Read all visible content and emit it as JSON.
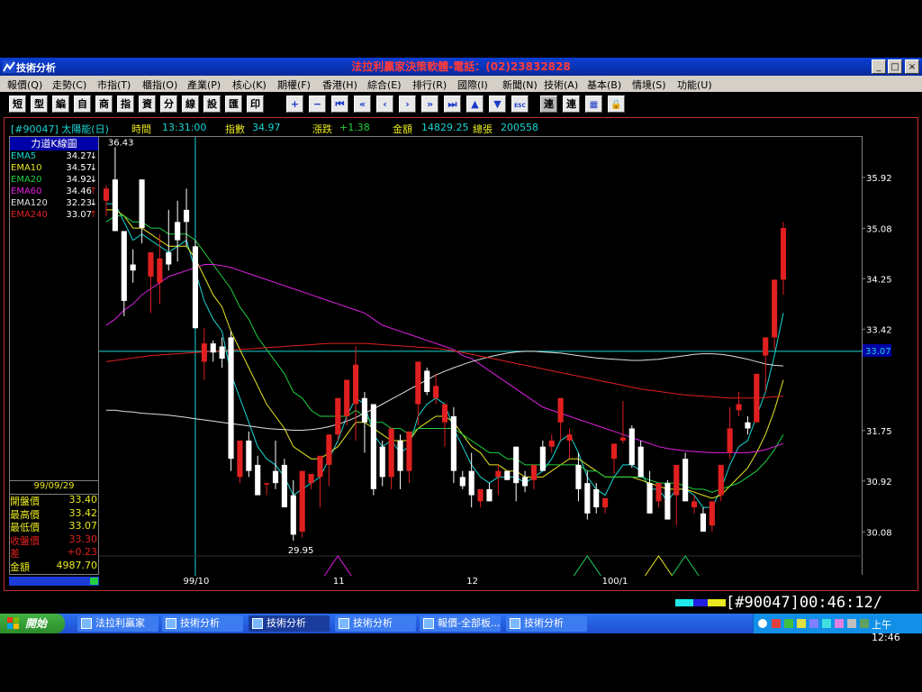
{
  "window": {
    "app_title": "技術分析",
    "center_title": "法拉利贏家決策軟體-電話：(02)23832828",
    "buttons": [
      "_",
      "□",
      "×"
    ]
  },
  "menu": [
    "報價(Q)",
    "走勢(C)",
    "市指(T)",
    "櫃指(O)",
    "產業(P)",
    "核心(K)",
    "期權(F)",
    "香港(H)",
    "綜合(E)",
    "排行(R)",
    "國際(I)",
    "新聞(N)",
    "技術(A)",
    "基本(B)",
    "情境(S)",
    "功能(U)"
  ],
  "toolbar": {
    "text_buttons": [
      "短",
      "型",
      "編",
      "自",
      "商",
      "指",
      "資",
      "分",
      "線",
      "設",
      "匯",
      "印"
    ],
    "icon_buttons": [
      "plus-icon",
      "minus-icon",
      "first-icon",
      "prev-page-icon",
      "prev-icon",
      "next-icon",
      "next-page-icon",
      "last-icon",
      "up-icon",
      "down-icon",
      "esc-icon"
    ],
    "esc_label": "ESC",
    "link_buttons": [
      "連",
      "連"
    ],
    "tail_icons": [
      "grid-icon",
      "lock-icon"
    ]
  },
  "infobar": {
    "code_name": "[#90047] 太陽能(日)",
    "time_label": "時間",
    "time_value": "13:31:00",
    "index_label": "指數",
    "index_value": "34.97",
    "change_label": "漲跌",
    "change_value": "+1.38",
    "amount_label": "金額",
    "amount_value": "14829.25",
    "total_label": "總張",
    "total_value": "200558"
  },
  "left_panel": {
    "title": "力道K線圖",
    "ema": [
      {
        "name": "EMA5",
        "value": "34.27",
        "arrow": "↓",
        "color": "#18d6d6"
      },
      {
        "name": "EMA10",
        "value": "34.57",
        "arrow": "↓",
        "color": "#e8e820"
      },
      {
        "name": "EMA20",
        "value": "34.92",
        "arrow": "↓",
        "color": "#20d040"
      },
      {
        "name": "EMA60",
        "value": "34.46",
        "arrow": "↑",
        "color": "#e020e0"
      },
      {
        "name": "EMA120",
        "value": "32.23",
        "arrow": "↓",
        "color": "#e0e0e0"
      },
      {
        "name": "EMA240",
        "value": "33.07",
        "arrow": "↑",
        "color": "#e02020"
      }
    ],
    "date": "99/09/29",
    "ohlc": [
      {
        "name": "開盤價",
        "value": "33.40",
        "color": "#e8e820"
      },
      {
        "name": "最高價",
        "value": "33.42",
        "color": "#e8e820"
      },
      {
        "name": "最低價",
        "value": "33.07",
        "color": "#e8e820"
      },
      {
        "name": "收盤價",
        "value": "33.30",
        "color": "#e02020"
      },
      {
        "name": "差",
        "value": "+0.23",
        "color": "#e02020"
      },
      {
        "name": "金額",
        "value": "4987.70",
        "color": "#e8e820"
      }
    ]
  },
  "chart_data": {
    "type": "candlestick",
    "y_range": [
      29.7,
      36.6
    ],
    "y_ticks": [
      "35.92",
      "35.08",
      "34.25",
      "33.42",
      "31.75",
      "30.92",
      "30.08"
    ],
    "current_price_label": "33.07",
    "current_price": 33.07,
    "x_labels": [
      {
        "label": "99/10",
        "index": 10
      },
      {
        "label": "11",
        "index": 26
      },
      {
        "label": "12",
        "index": 41
      },
      {
        "label": "100/1",
        "index": 57
      }
    ],
    "cursor_index": 10,
    "high_label": "36.43",
    "low_label": "29.95",
    "colors": {
      "up": "#e02020",
      "down": "#ffffff",
      "grid": "#18d6d6"
    },
    "candles": [
      [
        35.55,
        35.8,
        35.3,
        35.75
      ],
      [
        35.9,
        36.43,
        35.05,
        35.05
      ],
      [
        35.05,
        35.05,
        33.65,
        33.9
      ],
      [
        34.5,
        34.75,
        34.2,
        34.4
      ],
      [
        35.9,
        35.9,
        34.85,
        35.1
      ],
      [
        34.3,
        34.3,
        33.7,
        34.7
      ],
      [
        34.2,
        35.0,
        33.85,
        34.6
      ],
      [
        34.7,
        35.4,
        34.4,
        34.5
      ],
      [
        35.2,
        35.55,
        34.55,
        34.9
      ],
      [
        35.4,
        35.75,
        34.8,
        35.2
      ],
      [
        34.8,
        34.9,
        33.5,
        33.45
      ],
      [
        32.9,
        33.45,
        32.6,
        33.2
      ],
      [
        33.2,
        33.25,
        32.9,
        33.05
      ],
      [
        33.15,
        33.3,
        32.8,
        32.95
      ],
      [
        33.3,
        33.4,
        31.1,
        31.3
      ],
      [
        31.0,
        31.5,
        30.9,
        31.6
      ],
      [
        31.6,
        31.75,
        31.0,
        31.1
      ],
      [
        31.2,
        31.35,
        30.75,
        30.7
      ],
      [
        30.9,
        30.9,
        30.7,
        30.9
      ],
      [
        31.1,
        31.6,
        30.8,
        30.9
      ],
      [
        31.2,
        31.3,
        30.7,
        30.5
      ],
      [
        30.7,
        30.95,
        29.95,
        30.05
      ],
      [
        30.1,
        30.3,
        30.0,
        31.1
      ],
      [
        30.9,
        31.0,
        30.8,
        31.05
      ],
      [
        31.0,
        31.1,
        30.5,
        31.35
      ],
      [
        31.2,
        31.4,
        30.85,
        31.7
      ],
      [
        31.7,
        31.9,
        31.6,
        32.3
      ],
      [
        32.0,
        32.4,
        31.85,
        32.6
      ],
      [
        32.2,
        33.15,
        31.6,
        32.85
      ],
      [
        32.3,
        32.4,
        31.4,
        31.9
      ],
      [
        32.2,
        32.2,
        30.7,
        30.8
      ],
      [
        31.5,
        31.6,
        30.85,
        31.0
      ],
      [
        31.0,
        31.2,
        30.8,
        31.8
      ],
      [
        31.6,
        31.7,
        30.8,
        31.1
      ],
      [
        31.1,
        31.3,
        30.9,
        31.75
      ],
      [
        32.2,
        32.8,
        31.85,
        32.9
      ],
      [
        32.75,
        32.8,
        32.35,
        32.4
      ],
      [
        32.3,
        32.7,
        32.2,
        32.5
      ],
      [
        31.9,
        32.0,
        31.5,
        32.2
      ],
      [
        32.0,
        32.15,
        30.9,
        31.1
      ],
      [
        31.0,
        31.1,
        30.8,
        30.85
      ],
      [
        31.1,
        31.4,
        30.5,
        30.7
      ],
      [
        30.6,
        30.7,
        30.5,
        30.8
      ],
      [
        30.8,
        30.9,
        30.6,
        30.6
      ],
      [
        31.0,
        31.2,
        30.7,
        31.1
      ],
      [
        31.1,
        31.1,
        30.95,
        30.95
      ],
      [
        31.5,
        31.5,
        30.6,
        30.9
      ],
      [
        31.0,
        31.1,
        30.75,
        30.85
      ],
      [
        30.95,
        31.1,
        30.8,
        31.2
      ],
      [
        31.5,
        31.6,
        31.4,
        31.1
      ],
      [
        31.5,
        31.7,
        31.4,
        31.6
      ],
      [
        31.9,
        32.25,
        31.6,
        32.3
      ],
      [
        31.6,
        31.8,
        31.3,
        31.7
      ],
      [
        31.2,
        31.4,
        30.6,
        30.8
      ],
      [
        30.9,
        31.1,
        30.3,
        30.4
      ],
      [
        30.8,
        30.9,
        30.4,
        30.5
      ],
      [
        30.5,
        30.6,
        30.4,
        30.65
      ],
      [
        31.3,
        31.4,
        31.05,
        31.55
      ],
      [
        31.6,
        32.25,
        31.55,
        31.65
      ],
      [
        31.8,
        31.85,
        31.15,
        31.2
      ],
      [
        31.5,
        31.6,
        31.0,
        31.0
      ],
      [
        30.9,
        31.1,
        30.4,
        30.4
      ],
      [
        30.6,
        30.8,
        30.5,
        30.9
      ],
      [
        30.9,
        30.95,
        30.3,
        30.3
      ],
      [
        30.7,
        30.8,
        30.2,
        31.2
      ],
      [
        31.3,
        31.4,
        30.6,
        30.6
      ],
      [
        30.5,
        30.7,
        30.4,
        30.6
      ],
      [
        30.4,
        30.5,
        30.2,
        30.1
      ],
      [
        30.2,
        30.4,
        30.1,
        30.6
      ],
      [
        30.7,
        30.9,
        30.6,
        31.2
      ],
      [
        31.4,
        32.15,
        31.3,
        31.8
      ],
      [
        32.1,
        32.4,
        32.0,
        32.2
      ],
      [
        31.9,
        32.0,
        31.7,
        31.8
      ],
      [
        31.9,
        32.6,
        31.9,
        32.7
      ],
      [
        33.0,
        33.1,
        32.4,
        33.3
      ],
      [
        33.3,
        33.6,
        33.1,
        34.25
      ],
      [
        34.25,
        35.2,
        34.0,
        35.1
      ]
    ],
    "series": [
      {
        "name": "EMA5",
        "color": "#18d6d6",
        "values": [
          35.5,
          35.5,
          35.2,
          34.9,
          35.0,
          34.9,
          34.8,
          34.7,
          34.8,
          34.9,
          34.4,
          33.9,
          33.6,
          33.4,
          32.7,
          32.3,
          31.9,
          31.5,
          31.3,
          31.2,
          31.0,
          30.7,
          30.8,
          30.9,
          31.0,
          31.3,
          31.6,
          32.0,
          32.3,
          32.2,
          31.7,
          31.5,
          31.6,
          31.4,
          31.5,
          32.0,
          32.2,
          32.3,
          32.2,
          31.8,
          31.5,
          31.2,
          31.0,
          30.9,
          31.0,
          31.0,
          31.0,
          30.9,
          31.0,
          31.1,
          31.3,
          31.6,
          31.7,
          31.4,
          31.0,
          30.8,
          30.7,
          31.0,
          31.2,
          31.2,
          31.1,
          30.8,
          30.8,
          30.6,
          30.8,
          30.8,
          30.7,
          30.5,
          30.5,
          30.8,
          31.2,
          31.5,
          31.6,
          32.0,
          32.4,
          33.0,
          33.7
        ]
      },
      {
        "name": "EMA10",
        "color": "#e8e820",
        "values": [
          35.4,
          35.4,
          35.3,
          35.1,
          35.1,
          35.0,
          34.9,
          34.8,
          34.8,
          34.8,
          34.6,
          34.3,
          34.0,
          33.8,
          33.4,
          33.1,
          32.8,
          32.5,
          32.2,
          32.0,
          31.8,
          31.5,
          31.4,
          31.3,
          31.3,
          31.4,
          31.5,
          31.7,
          31.9,
          31.9,
          31.8,
          31.7,
          31.6,
          31.6,
          31.6,
          31.8,
          31.9,
          32.0,
          32.0,
          31.9,
          31.7,
          31.5,
          31.4,
          31.2,
          31.2,
          31.1,
          31.1,
          31.0,
          31.0,
          31.0,
          31.1,
          31.2,
          31.3,
          31.3,
          31.2,
          31.1,
          31.0,
          31.0,
          31.0,
          31.0,
          30.95,
          30.9,
          30.85,
          30.8,
          30.8,
          30.8,
          30.75,
          30.7,
          30.65,
          30.7,
          30.85,
          31.0,
          31.15,
          31.4,
          31.7,
          32.1,
          32.6
        ]
      },
      {
        "name": "EMA20",
        "color": "#20d040",
        "values": [
          35.2,
          35.3,
          35.3,
          35.2,
          35.2,
          35.1,
          35.1,
          35.0,
          35.0,
          35.0,
          34.9,
          34.7,
          34.5,
          34.3,
          34.1,
          33.8,
          33.6,
          33.3,
          33.1,
          32.9,
          32.7,
          32.4,
          32.3,
          32.1,
          32.0,
          32.0,
          32.0,
          32.0,
          32.1,
          32.0,
          31.9,
          31.9,
          31.8,
          31.8,
          31.7,
          31.8,
          31.8,
          31.8,
          31.8,
          31.8,
          31.7,
          31.6,
          31.5,
          31.4,
          31.4,
          31.3,
          31.3,
          31.2,
          31.2,
          31.2,
          31.2,
          31.2,
          31.2,
          31.2,
          31.1,
          31.1,
          31.0,
          31.0,
          31.0,
          31.0,
          31.0,
          30.95,
          30.9,
          30.9,
          30.9,
          30.85,
          30.8,
          30.8,
          30.75,
          30.8,
          30.85,
          30.9,
          31.0,
          31.1,
          31.25,
          31.45,
          31.7
        ]
      },
      {
        "name": "EMA60",
        "color": "#e020e0",
        "values": [
          33.5,
          33.6,
          33.75,
          33.85,
          34.0,
          34.1,
          34.2,
          34.3,
          34.35,
          34.4,
          34.45,
          34.5,
          34.5,
          34.48,
          34.45,
          34.4,
          34.35,
          34.3,
          34.25,
          34.2,
          34.15,
          34.1,
          34.05,
          34.0,
          33.95,
          33.9,
          33.85,
          33.8,
          33.75,
          33.7,
          33.6,
          33.5,
          33.45,
          33.4,
          33.35,
          33.3,
          33.25,
          33.2,
          33.15,
          33.1,
          33.0,
          32.95,
          32.85,
          32.75,
          32.65,
          32.55,
          32.45,
          32.35,
          32.25,
          32.15,
          32.1,
          32.05,
          32.0,
          31.95,
          31.9,
          31.85,
          31.8,
          31.75,
          31.7,
          31.65,
          31.6,
          31.55,
          31.5,
          31.47,
          31.45,
          31.43,
          31.42,
          31.41,
          31.4,
          31.4,
          31.4,
          31.4,
          31.4,
          31.42,
          31.45,
          31.5,
          31.55
        ]
      },
      {
        "name": "EMA120",
        "color": "#e0e0e0",
        "values": [
          32.1,
          32.1,
          32.08,
          32.07,
          32.05,
          32.04,
          32.03,
          32.02,
          32.0,
          31.98,
          31.96,
          31.94,
          31.92,
          31.9,
          31.88,
          31.86,
          31.84,
          31.82,
          31.8,
          31.79,
          31.78,
          31.77,
          31.77,
          31.78,
          31.8,
          31.83,
          31.87,
          31.92,
          31.98,
          32.05,
          32.12,
          32.2,
          32.28,
          32.36,
          32.44,
          32.52,
          32.6,
          32.68,
          32.74,
          32.8,
          32.85,
          32.9,
          32.94,
          32.98,
          33.01,
          33.04,
          33.06,
          33.07,
          33.07,
          33.06,
          33.05,
          33.04,
          33.02,
          33.0,
          32.98,
          32.96,
          32.95,
          32.94,
          32.93,
          32.92,
          32.92,
          32.93,
          32.94,
          32.96,
          32.98,
          33.0,
          33.02,
          33.03,
          33.03,
          33.02,
          33.0,
          32.97,
          32.94,
          32.9,
          32.86,
          32.84,
          32.83
        ]
      },
      {
        "name": "EMA240",
        "color": "#e02020",
        "values": [
          32.9,
          32.92,
          32.94,
          32.96,
          32.98,
          33.0,
          33.01,
          33.02,
          33.03,
          33.04,
          33.05,
          33.06,
          33.07,
          33.08,
          33.09,
          33.1,
          33.11,
          33.12,
          33.13,
          33.14,
          33.15,
          33.16,
          33.17,
          33.18,
          33.19,
          33.2,
          33.2,
          33.2,
          33.2,
          33.2,
          33.19,
          33.18,
          33.17,
          33.16,
          33.15,
          33.14,
          33.13,
          33.12,
          33.1,
          33.08,
          33.05,
          33.02,
          32.99,
          32.96,
          32.93,
          32.9,
          32.87,
          32.84,
          32.81,
          32.78,
          32.75,
          32.72,
          32.69,
          32.66,
          32.63,
          32.6,
          32.57,
          32.54,
          32.51,
          32.48,
          32.45,
          32.43,
          32.41,
          32.39,
          32.37,
          32.35,
          32.34,
          32.33,
          32.32,
          32.31,
          32.3,
          32.3,
          32.3,
          32.3,
          32.31,
          32.32,
          32.33
        ]
      }
    ],
    "signals": [
      26,
      54,
      62,
      65
    ]
  },
  "bottom": {
    "code": "[#90047]00:46:12/"
  },
  "taskbar": {
    "start_label": "開始",
    "tasks": [
      {
        "label": "法拉利贏家",
        "active": false
      },
      {
        "label": "技術分析",
        "active": false
      },
      {
        "label": "技術分析",
        "active": true
      },
      {
        "label": "技術分析",
        "active": false
      },
      {
        "label": "報價-全部板...",
        "active": false
      },
      {
        "label": "技術分析",
        "active": false
      }
    ],
    "clock": "上午 12:46"
  }
}
